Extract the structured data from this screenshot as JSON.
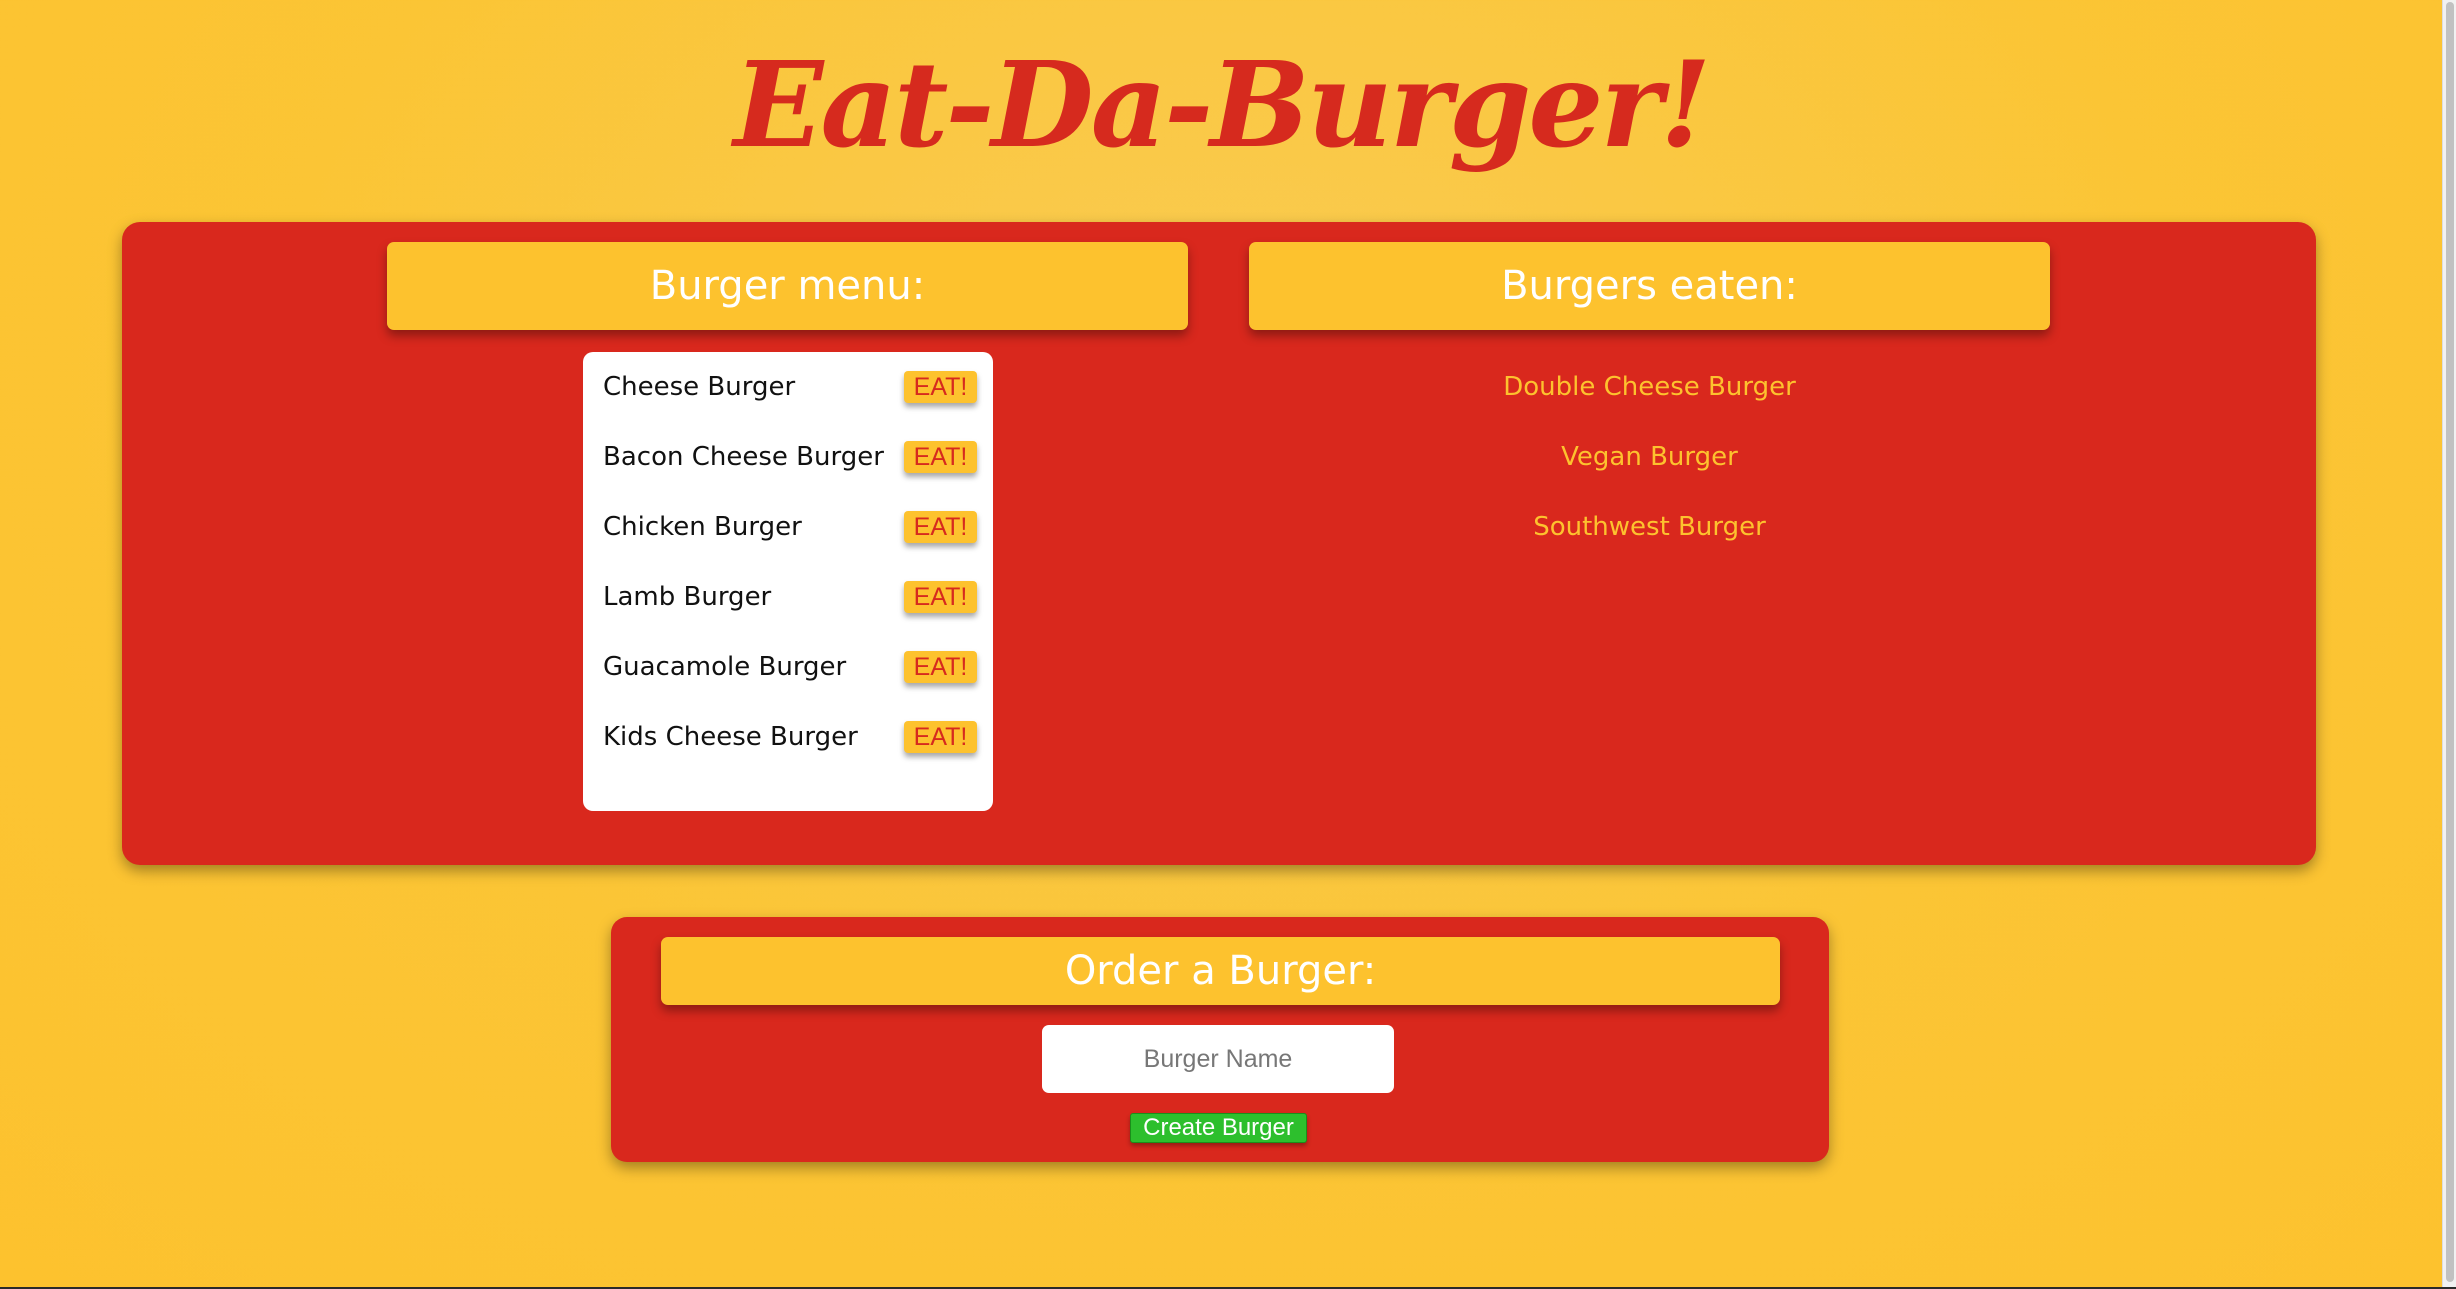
{
  "title": "Eat-Da-Burger!",
  "menu": {
    "header": "Burger menu:",
    "eat_label": "EAT!",
    "items": [
      {
        "name": "Cheese Burger"
      },
      {
        "name": "Bacon Cheese Burger"
      },
      {
        "name": "Chicken Burger"
      },
      {
        "name": "Lamb Burger"
      },
      {
        "name": "Guacamole Burger"
      },
      {
        "name": "Kids Cheese Burger"
      }
    ]
  },
  "eaten": {
    "header": "Burgers eaten:",
    "items": [
      {
        "name": "Double Cheese Burger"
      },
      {
        "name": "Vegan Burger"
      },
      {
        "name": "Southwest Burger"
      }
    ]
  },
  "order": {
    "header": "Order a Burger:",
    "input_placeholder": "Burger Name",
    "input_value": "",
    "submit_label": "Create Burger"
  },
  "colors": {
    "background": "#fdc22e",
    "panel": "#d9281d",
    "title": "#d62a1e",
    "eaten_text": "#fdc22e",
    "create_button": "#2dbf2d"
  }
}
